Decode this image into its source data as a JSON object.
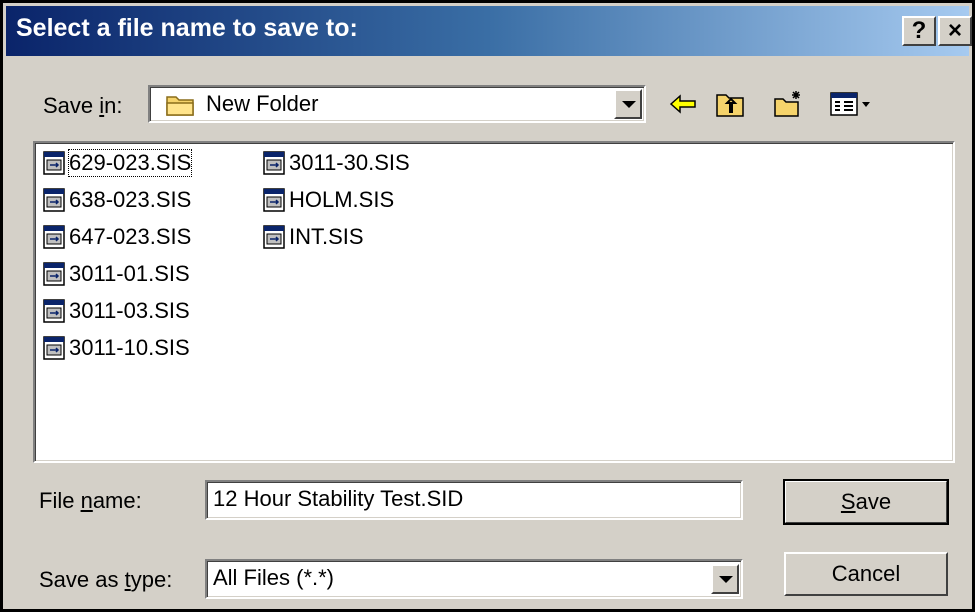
{
  "window": {
    "title": "Select a file name to save to:",
    "help_label": "?",
    "close_label": "×"
  },
  "save_in": {
    "label_pre": "Save ",
    "label_accel": "i",
    "label_post": "n:",
    "value": "New Folder"
  },
  "files": [
    {
      "name": "629-023.SIS",
      "focused": true
    },
    {
      "name": "638-023.SIS"
    },
    {
      "name": "647-023.SIS"
    },
    {
      "name": "3011-01.SIS"
    },
    {
      "name": "3011-03.SIS"
    },
    {
      "name": "3011-10.SIS"
    },
    {
      "name": "3011-30.SIS"
    },
    {
      "name": "HOLM.SIS"
    },
    {
      "name": "INT.SIS"
    }
  ],
  "file_name": {
    "label_pre": "File ",
    "label_accel": "n",
    "label_post": "ame:",
    "value": "12 Hour Stability Test.SID"
  },
  "save_as_type": {
    "label_pre": "Save as ",
    "label_accel": "t",
    "label_post": "ype:",
    "value": "All Files (*.*)"
  },
  "buttons": {
    "save_accel": "S",
    "save_rest": "ave",
    "cancel": "Cancel"
  },
  "icons": {
    "folder": "folder-icon",
    "back": "back-arrow-icon",
    "up": "up-folder-icon",
    "new_folder": "new-folder-icon",
    "view_menu": "view-menu-icon",
    "file": "sis-file-icon"
  }
}
